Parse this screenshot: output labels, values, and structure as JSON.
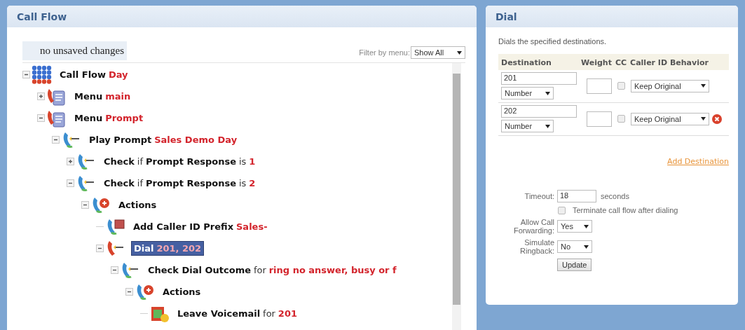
{
  "call_flow": {
    "title": "Call Flow",
    "status": "no unsaved changes",
    "filter": {
      "label": "Filter by menu:",
      "value": "Show All"
    },
    "tree": [
      {
        "kind": "flow",
        "expanded": true,
        "selected": false,
        "parts": [
          {
            "text": "Call Flow",
            "kind": "name"
          },
          {
            "text": "Day",
            "kind": "value"
          }
        ],
        "children": [
          {
            "kind": "menu",
            "expanded": false,
            "selected": false,
            "parts": [
              {
                "text": "Menu",
                "kind": "name"
              },
              {
                "text": "main",
                "kind": "value"
              }
            ]
          },
          {
            "kind": "menu",
            "expanded": true,
            "selected": false,
            "parts": [
              {
                "text": "Menu",
                "kind": "name"
              },
              {
                "text": "Prompt",
                "kind": "value"
              }
            ],
            "children": [
              {
                "kind": "prompt",
                "expanded": true,
                "selected": false,
                "parts": [
                  {
                    "text": "Play Prompt",
                    "kind": "name"
                  },
                  {
                    "text": "Sales Demo Day",
                    "kind": "value"
                  }
                ],
                "children": [
                  {
                    "kind": "check",
                    "expanded": false,
                    "selected": false,
                    "parts": [
                      {
                        "text": "Check",
                        "kind": "name"
                      },
                      {
                        "text": "if",
                        "kind": "word"
                      },
                      {
                        "text": "Prompt Response",
                        "kind": "name"
                      },
                      {
                        "text": "is",
                        "kind": "word"
                      },
                      {
                        "text": "1",
                        "kind": "value"
                      }
                    ]
                  },
                  {
                    "kind": "check",
                    "expanded": true,
                    "selected": false,
                    "parts": [
                      {
                        "text": "Check",
                        "kind": "name"
                      },
                      {
                        "text": "if",
                        "kind": "word"
                      },
                      {
                        "text": "Prompt Response",
                        "kind": "name"
                      },
                      {
                        "text": "is",
                        "kind": "word"
                      },
                      {
                        "text": "2",
                        "kind": "value"
                      }
                    ],
                    "children": [
                      {
                        "kind": "actions",
                        "expanded": true,
                        "selected": false,
                        "parts": [
                          {
                            "text": "Actions",
                            "kind": "name"
                          }
                        ],
                        "children": [
                          {
                            "kind": "callerid",
                            "selected": false,
                            "parts": [
                              {
                                "text": "Add Caller ID Prefix",
                                "kind": "name"
                              },
                              {
                                "text": "Sales-",
                                "kind": "value"
                              }
                            ]
                          },
                          {
                            "kind": "dial",
                            "expanded": true,
                            "selected": true,
                            "parts": [
                              {
                                "text": "Dial",
                                "kind": "name"
                              },
                              {
                                "text": "201, 202",
                                "kind": "value"
                              }
                            ],
                            "children": [
                              {
                                "kind": "check",
                                "expanded": true,
                                "selected": false,
                                "parts": [
                                  {
                                    "text": "Check Dial Outcome",
                                    "kind": "name"
                                  },
                                  {
                                    "text": "for",
                                    "kind": "word"
                                  },
                                  {
                                    "text": "ring no answer, busy or f",
                                    "kind": "value"
                                  }
                                ],
                                "children": [
                                  {
                                    "kind": "actions",
                                    "expanded": true,
                                    "selected": false,
                                    "parts": [
                                      {
                                        "text": "Actions",
                                        "kind": "name"
                                      }
                                    ],
                                    "children": [
                                      {
                                        "kind": "voicemail",
                                        "selected": false,
                                        "parts": [
                                          {
                                            "text": "Leave Voicemail",
                                            "kind": "name"
                                          },
                                          {
                                            "text": "for",
                                            "kind": "word"
                                          },
                                          {
                                            "text": "201",
                                            "kind": "value"
                                          }
                                        ]
                                      }
                                    ]
                                  }
                                ]
                              }
                            ]
                          }
                        ]
                      }
                    ]
                  }
                ]
              }
            ]
          }
        ]
      }
    ]
  },
  "dial": {
    "title": "Dial",
    "description": "Dials the specified destinations.",
    "columns": [
      "Destination",
      "Weight",
      "CC",
      "Caller ID Behavior"
    ],
    "destinations": [
      {
        "number": "201",
        "type": "Number",
        "cc": false,
        "caller_id": "Keep Original",
        "removable": false
      },
      {
        "number": "202",
        "type": "Number",
        "cc": false,
        "caller_id": "Keep Original",
        "removable": true
      }
    ],
    "add_link": "Add Destination",
    "timeout": {
      "label": "Timeout:",
      "value": "18",
      "unit": "seconds"
    },
    "terminate": {
      "label": "Terminate call flow after dialing",
      "checked": false
    },
    "forwarding": {
      "label": "Allow Call Forwarding:",
      "value": "Yes"
    },
    "ringback": {
      "label": "Simulate Ringback:",
      "value": "No"
    },
    "button": "Update"
  }
}
